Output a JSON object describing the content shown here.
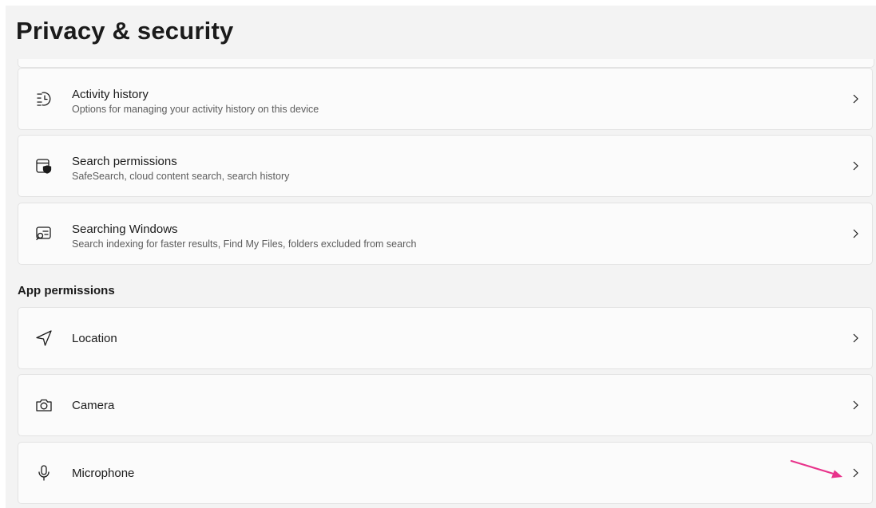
{
  "page": {
    "title": "Privacy & security"
  },
  "windows_permissions": [
    {
      "title": "Activity history",
      "subtitle": "Options for managing your activity history on this device",
      "icon": "activity-history-icon"
    },
    {
      "title": "Search permissions",
      "subtitle": "SafeSearch, cloud content search, search history",
      "icon": "search-permissions-icon"
    },
    {
      "title": "Searching Windows",
      "subtitle": "Search indexing for faster results, Find My Files, folders excluded from search",
      "icon": "searching-windows-icon"
    }
  ],
  "app_permissions": {
    "label": "App permissions",
    "items": [
      {
        "title": "Location",
        "icon": "location-icon"
      },
      {
        "title": "Camera",
        "icon": "camera-icon"
      },
      {
        "title": "Microphone",
        "icon": "microphone-icon"
      }
    ]
  },
  "annotation": {
    "type": "arrow",
    "color": "#e8338b",
    "target": "microphone-chevron"
  }
}
